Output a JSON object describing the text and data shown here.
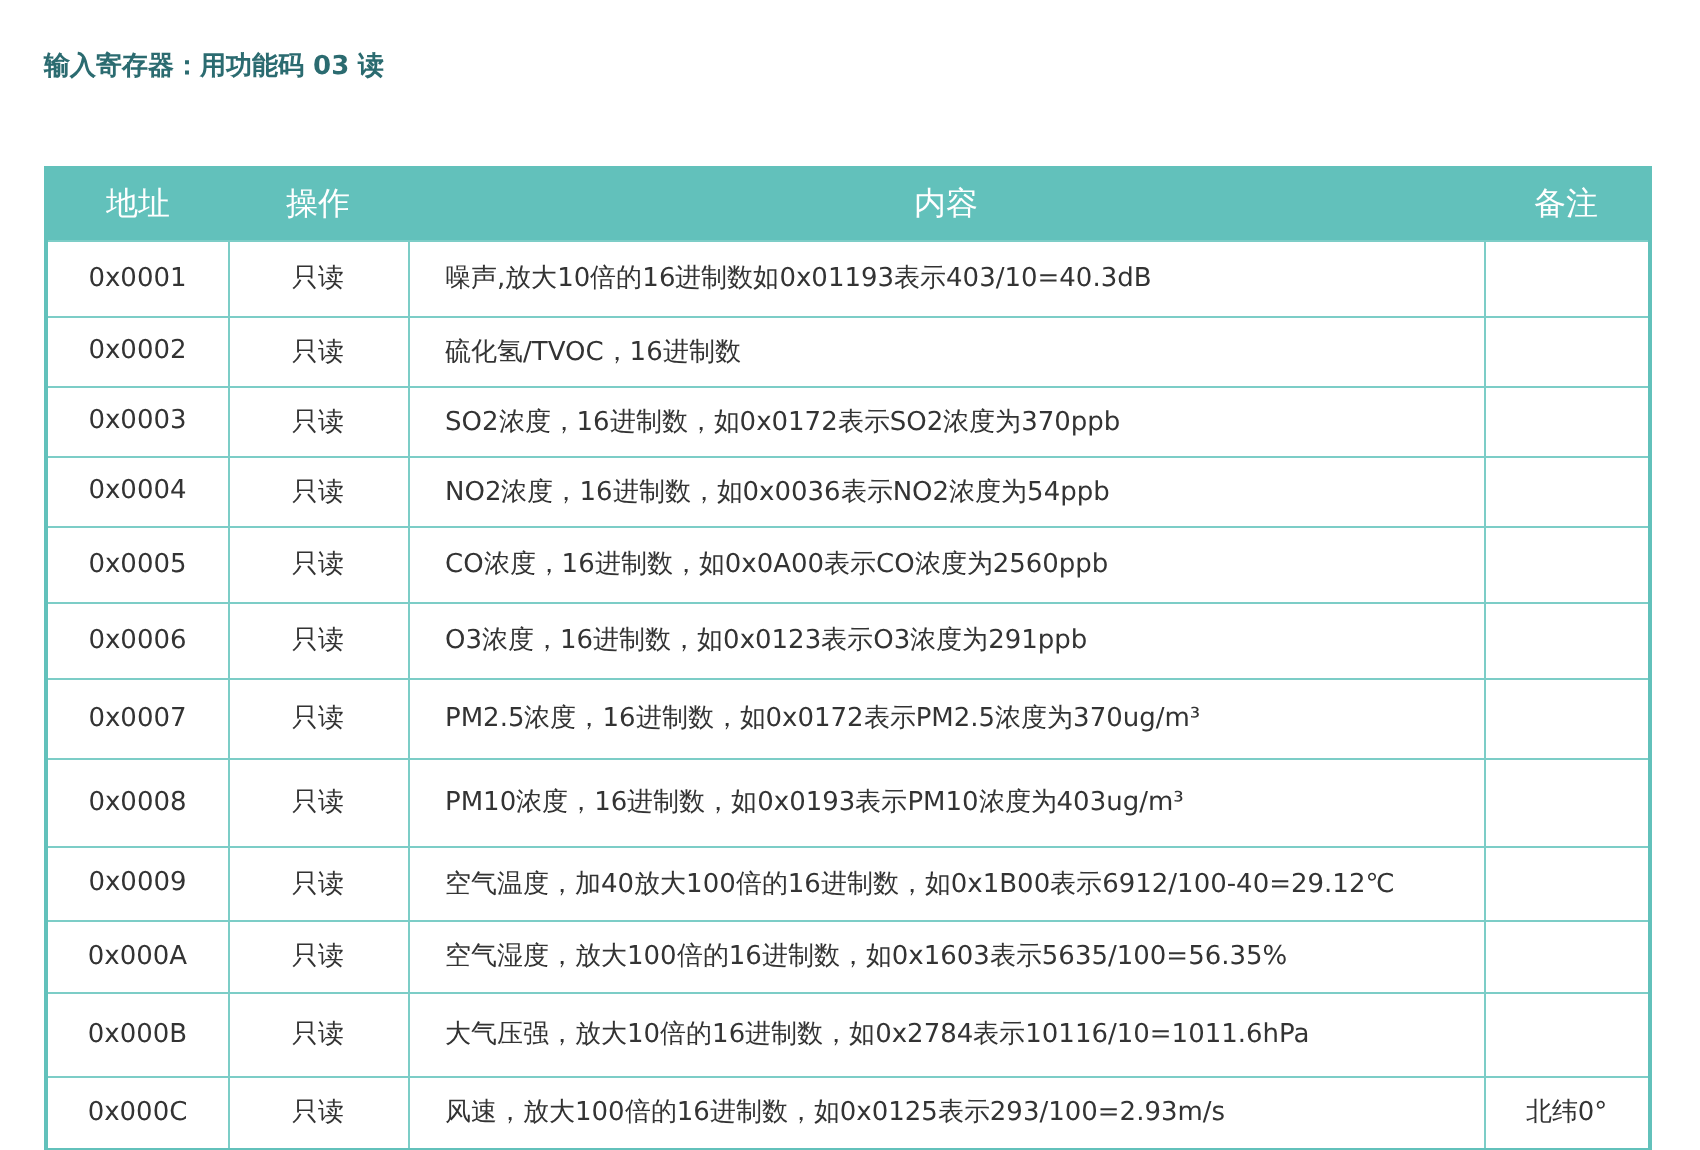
{
  "title": "输入寄存器：用功能码 03 读",
  "table": {
    "columns": [
      "地址",
      "操作",
      "内容",
      "备注"
    ],
    "rows": [
      {
        "address": "0x0001",
        "access": "只读",
        "content": "噪声,放大10倍的16进制数如0x01193表示403/10=40.3dB"
      },
      {
        "address": "0x0002",
        "access": "只读",
        "content": "硫化氢/TVOC，16进制数"
      },
      {
        "address": "0x0003",
        "access": "只读",
        "content": "SO2浓度，16进制数，如0x0172表示SO2浓度为370ppb"
      },
      {
        "address": "0x0004",
        "access": "只读",
        "content": "NO2浓度，16进制数，如0x0036表示NO2浓度为54ppb"
      },
      {
        "address": "0x0005",
        "access": "只读",
        "content": "CO浓度，16进制数，如0x0A00表示CO浓度为2560ppb"
      },
      {
        "address": "0x0006",
        "access": "只读",
        "content": "O3浓度，16进制数，如0x0123表示O3浓度为291ppb"
      },
      {
        "address": "0x0007",
        "access": "只读",
        "content": "PM2.5浓度，16进制数，如0x0172表示PM2.5浓度为370ug/m³"
      },
      {
        "address": "0x0008",
        "access": "只读",
        "content": "PM10浓度，16进制数，如0x0193表示PM10浓度为403ug/m³"
      },
      {
        "address": "0x0009",
        "access": "只读",
        "content": "空气温度，加40放大100倍的16进制数，如0x1B00表示6912/100-40=29.12℃"
      },
      {
        "address": "0x000A",
        "access": "只读",
        "content": "空气湿度，放大100倍的16进制数，如0x1603表示5635/100=56.35%"
      },
      {
        "address": "0x000B",
        "access": "只读",
        "content": "大气压强，放大10倍的16进制数，如0x2784表示10116/10=1011.6hPa"
      },
      {
        "address": "0x000C",
        "access": "只读",
        "content": "风速，放大100倍的16进制数，如0x0125表示293/100=2.93m/s",
        "note": "北纬0°"
      }
    ]
  }
}
